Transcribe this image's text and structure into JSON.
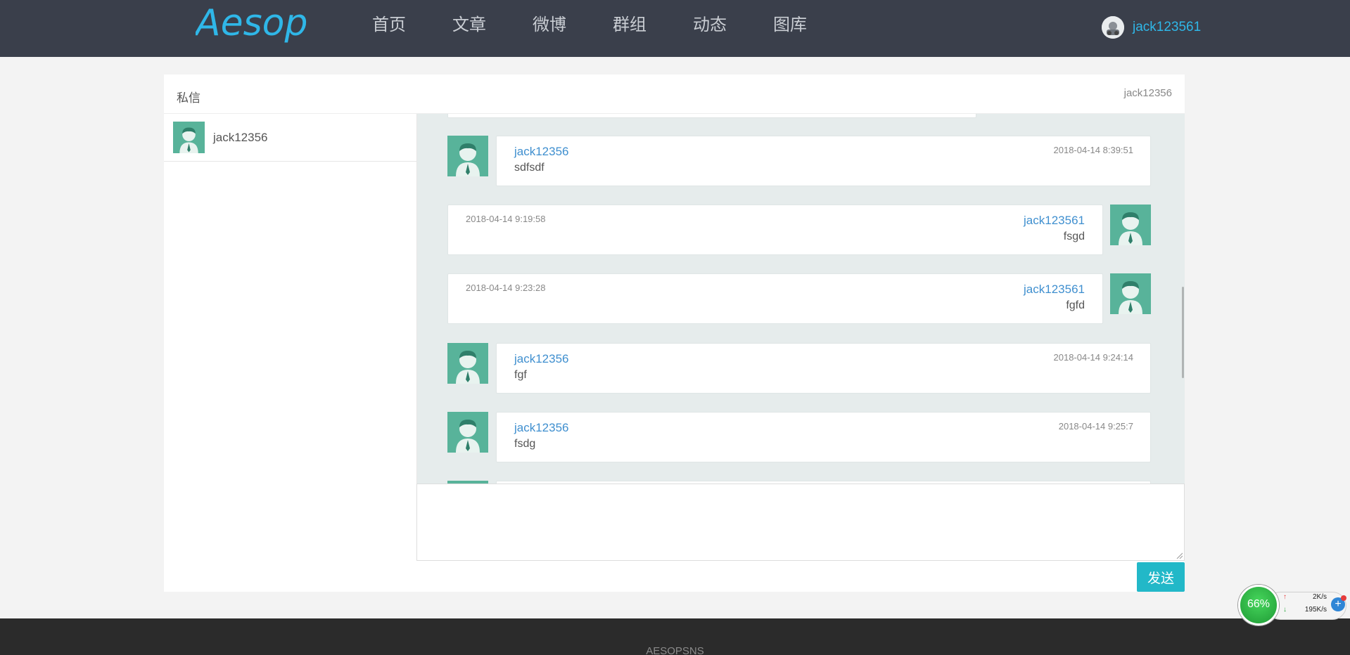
{
  "header": {
    "logo_text": "Aesop",
    "nav": [
      "首页",
      "文章",
      "微博",
      "群组",
      "动态",
      "图库"
    ],
    "user_name": "jack123561"
  },
  "panel": {
    "title": "私信",
    "peer_name": "jack12356"
  },
  "contacts": [
    {
      "name": "jack12356"
    }
  ],
  "messages": [
    {
      "side": "left",
      "user": "jack12356",
      "text": "sdfsdf",
      "time": "2018-04-14 8:39:51"
    },
    {
      "side": "right",
      "user": "jack123561",
      "text": "fsgd",
      "time": "2018-04-14 9:19:58"
    },
    {
      "side": "right",
      "user": "jack123561",
      "text": "fgfd",
      "time": "2018-04-14 9:23:28"
    },
    {
      "side": "left",
      "user": "jack12356",
      "text": "fgf",
      "time": "2018-04-14 9:24:14"
    },
    {
      "side": "left",
      "user": "jack12356",
      "text": "fsdg",
      "time": "2018-04-14 9:25:7"
    }
  ],
  "composer": {
    "placeholder": "",
    "send_label": "发送"
  },
  "footer": {
    "text": "AESOPSNS"
  },
  "net_widget": {
    "percent": "66%",
    "up": "2K/s",
    "down": "195K/s"
  },
  "colors": {
    "header_bg": "#3a3f4b",
    "accent": "#2fb7e8",
    "send_button": "#22b8c8",
    "avatar_bg": "#58b39a",
    "chat_bg": "#e6ecec"
  }
}
